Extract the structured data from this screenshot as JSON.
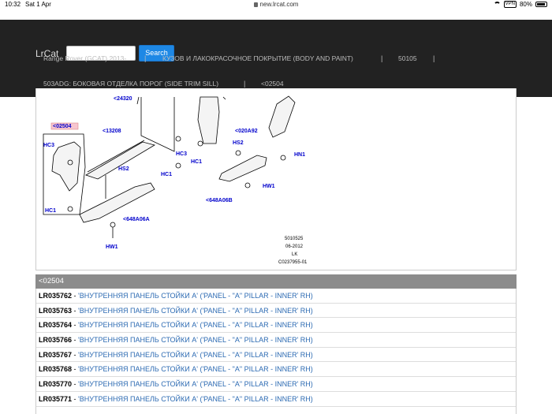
{
  "status_bar": {
    "time": "10:32",
    "date": "Sat 1 Apr",
    "url": "new.lrcat.com",
    "vpn": "VPN",
    "battery": "80%"
  },
  "navbar": {
    "brand": "LrCat",
    "search_placeholder": "",
    "search_button": "Search",
    "breadcrumbs": [
      "Range Rover (GCAT) 2013-",
      "КУЗОВ И ЛАКОКРАСОЧНОЕ ПОКРЫТИЕ (BODY AND PAINT)",
      "50105",
      "503ADG: БОКОВАЯ ОТДЕЛКА ПОРОГ (SIDE TRIM SILL)",
      "<02504"
    ],
    "separator": "|"
  },
  "diagram": {
    "labels": {
      "l24320": "<24320",
      "l02504": "<02504",
      "l13208": "<13208",
      "hc3a": "HC3",
      "hc3b": "HC3",
      "hc1a": "HC1",
      "hc1b": "HC1",
      "hc1c": "HC1",
      "hs2a": "HS2",
      "hs2b": "HS2",
      "l648a06a": "<648A06A",
      "l648a06b": "<648A06B",
      "l020a92": "<020A92",
      "hn1": "HN1",
      "hw1a": "HW1",
      "hw1b": "HW1"
    },
    "notes": [
      "5010525",
      "06-2012",
      "LK",
      "C0237955-01"
    ]
  },
  "parts_table": {
    "header": "<02504",
    "rows": [
      {
        "part": "LR035762",
        "desc": "'ВНУТРЕННЯЯ ПАНЕЛЬ СТОЙКИ А' ('PANEL - \"A\" PILLAR - INNER' RH)"
      },
      {
        "part": "LR035763",
        "desc": "'ВНУТРЕННЯЯ ПАНЕЛЬ СТОЙКИ А' ('PANEL - \"A\" PILLAR - INNER' RH)"
      },
      {
        "part": "LR035764",
        "desc": "'ВНУТРЕННЯЯ ПАНЕЛЬ СТОЙКИ А' ('PANEL - \"A\" PILLAR - INNER' RH)"
      },
      {
        "part": "LR035766",
        "desc": "'ВНУТРЕННЯЯ ПАНЕЛЬ СТОЙКИ А' ('PANEL - \"A\" PILLAR - INNER' RH)"
      },
      {
        "part": "LR035767",
        "desc": "'ВНУТРЕННЯЯ ПАНЕЛЬ СТОЙКИ А' ('PANEL - \"A\" PILLAR - INNER' RH)"
      },
      {
        "part": "LR035768",
        "desc": "'ВНУТРЕННЯЯ ПАНЕЛЬ СТОЙКИ А' ('PANEL - \"A\" PILLAR - INNER' RH)"
      },
      {
        "part": "LR035770",
        "desc": "'ВНУТРЕННЯЯ ПАНЕЛЬ СТОЙКИ А' ('PANEL - \"A\" PILLAR - INNER' RH)"
      },
      {
        "part": "LR035771",
        "desc": "'ВНУТРЕННЯЯ ПАНЕЛЬ СТОЙКИ А' ('PANEL - \"A\" PILLAR - INNER' RH)"
      }
    ]
  }
}
